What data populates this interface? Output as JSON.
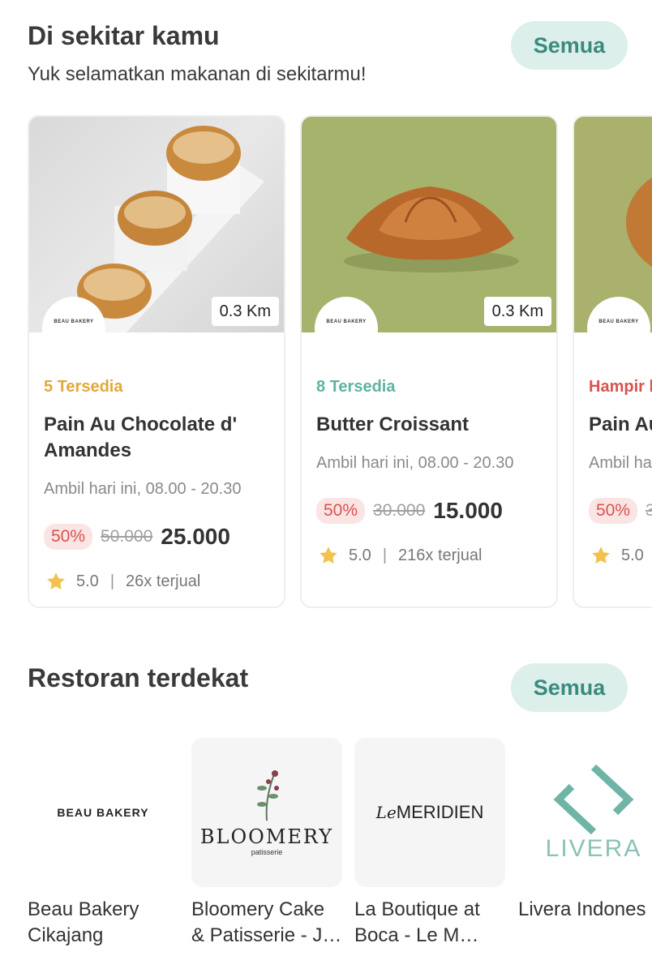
{
  "nearby": {
    "title": "Di sekitar kamu",
    "subtitle": "Yuk selamatkan makanan di sekitarmu!",
    "all_label": "Semua",
    "cards": [
      {
        "distance": "0.3 Km",
        "store_logo_text": "BEAU BAKERY",
        "availability": "5 Tersedia",
        "availability_color": "#e0a93a",
        "name": "Pain Au Chocolate d' Amandes",
        "pickup": "Ambil hari ini, 08.00 - 20.30",
        "discount": "50%",
        "old_price": "50.000",
        "new_price": "25.000",
        "rating": "5.0",
        "sold": "26x terjual"
      },
      {
        "distance": "0.3 Km",
        "store_logo_text": "BEAU BAKERY",
        "availability": "8 Tersedia",
        "availability_color": "#5fb3a3",
        "name": "Butter Croissant",
        "pickup": "Ambil hari ini, 08.00 - 20.30",
        "discount": "50%",
        "old_price": "30.000",
        "new_price": "15.000",
        "rating": "5.0",
        "sold": "216x terjual"
      },
      {
        "store_logo_text": "BEAU BAKERY",
        "availability": "Hampir h",
        "availability_color": "#d9534f",
        "name": "Pain Au",
        "pickup": "Ambil ha",
        "discount": "50%",
        "old_price": "3",
        "rating": "5.0"
      }
    ]
  },
  "restaurants": {
    "title": "Restoran terdekat",
    "all_label": "Semua",
    "items": [
      {
        "name": "Beau Bakery Cikajang",
        "logo_text": "BEAU BAKERY"
      },
      {
        "name": "Bloomery Cake & Patisserie - J…",
        "logo_text": "BLOOMERY",
        "logo_sub": "patisserie"
      },
      {
        "name": "La Boutique at Boca - Le M…",
        "logo_prefix": "Le",
        "logo_text": "MERIDIEN"
      },
      {
        "name": "Livera Indones",
        "logo_text": "LIVERA"
      }
    ]
  },
  "colors": {
    "accent": "#3a8a7f",
    "accent_bg": "#dcefea",
    "discount": "#d9534f",
    "star": "#f2c14e"
  }
}
